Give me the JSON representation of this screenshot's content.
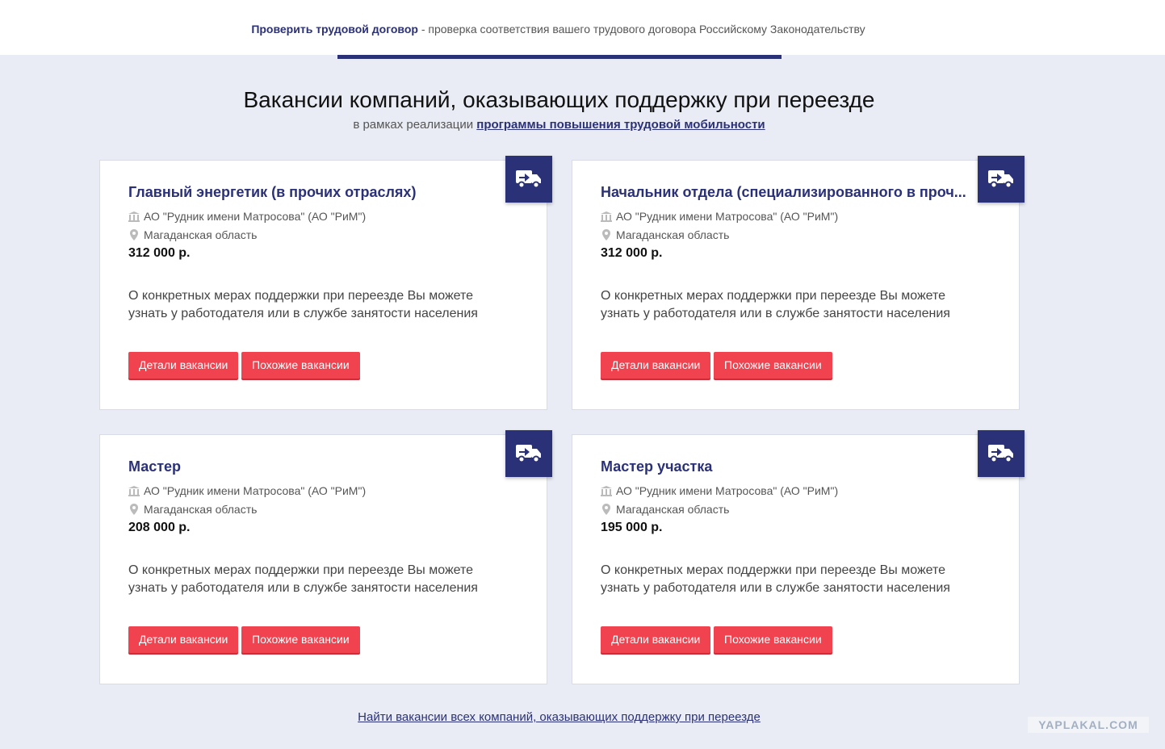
{
  "topbar": {
    "link_text": "Проверить трудовой договор",
    "description": " - проверка соответствия вашего трудового договора Российскому Законодательству"
  },
  "heading": "Вакансии компаний, оказывающих поддержку при переезде",
  "subheading": {
    "prefix": "в рамках реализации ",
    "link_text": "программы повышения трудовой мобильности"
  },
  "colors": {
    "brand": "#2b3177",
    "button": "#f0424f",
    "background": "#e9ecf4"
  },
  "vacancies": [
    {
      "title": "Главный энергетик (в прочих отраслях)",
      "company": "АО \"Рудник имени Матросова\" (АО \"РиМ\")",
      "region": "Магаданская область",
      "salary": "312 000 р.",
      "description": "О конкретных мерах поддержки при переезде Вы можете узнать у работодателя или в службе занятости населения",
      "details_label": "Детали вакансии",
      "similar_label": "Похожие вакансии"
    },
    {
      "title": "Начальник отдела (специализированного в проч...",
      "company": "АО \"Рудник имени Матросова\" (АО \"РиМ\")",
      "region": "Магаданская область",
      "salary": "312 000 р.",
      "description": "О конкретных мерах поддержки при переезде Вы можете узнать у работодателя или в службе занятости населения",
      "details_label": "Детали вакансии",
      "similar_label": "Похожие вакансии"
    },
    {
      "title": "Мастер",
      "company": "АО \"Рудник имени Матросова\" (АО \"РиМ\")",
      "region": "Магаданская область",
      "salary": "208 000 р.",
      "description": "О конкретных мерах поддержки при переезде Вы можете узнать у работодателя или в службе занятости населения",
      "details_label": "Детали вакансии",
      "similar_label": "Похожие вакансии"
    },
    {
      "title": "Мастер участка",
      "company": "АО \"Рудник имени Матросова\" (АО \"РиМ\")",
      "region": "Магаданская область",
      "salary": "195 000 р.",
      "description": "О конкретных мерах поддержки при переезде Вы можете узнать у работодателя или в службе занятости населения",
      "details_label": "Детали вакансии",
      "similar_label": "Похожие вакансии"
    }
  ],
  "footer_link": "Найти вакансии всех компаний, оказывающих поддержку при переезде",
  "watermark": "YAPLAKAL.COM"
}
